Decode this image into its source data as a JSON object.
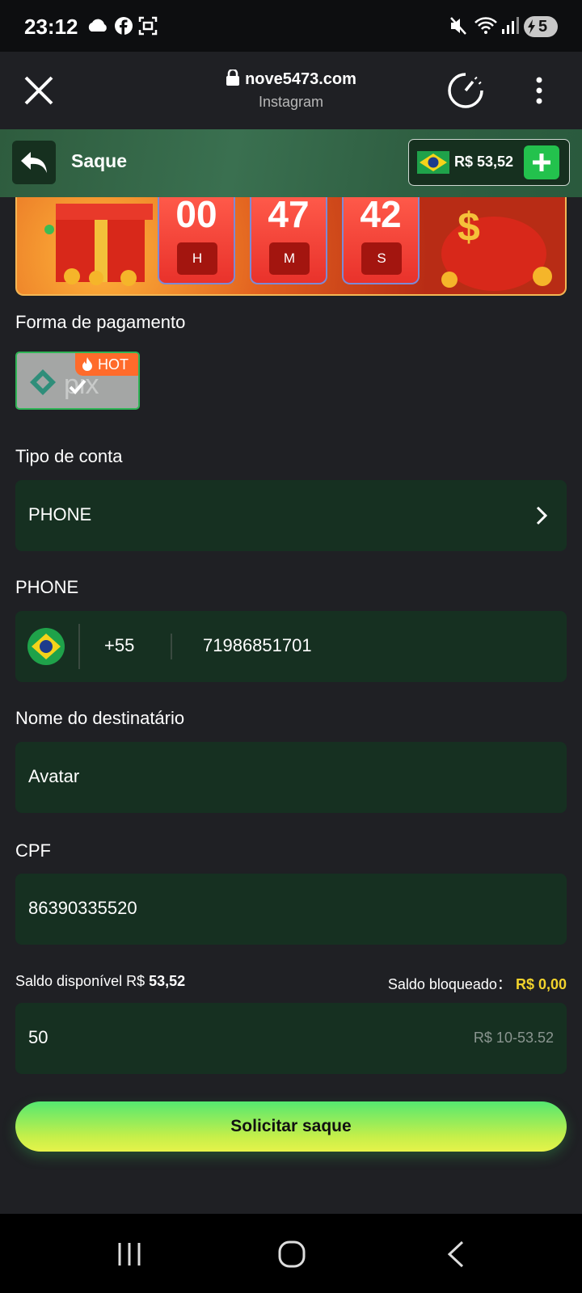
{
  "status_bar": {
    "time": "23:12",
    "battery": "5"
  },
  "browser": {
    "url": "nove5473.com",
    "source": "Instagram"
  },
  "header": {
    "title": "Saque",
    "balance": "R$ 53,52"
  },
  "timer": {
    "hours": "00",
    "minutes": "47",
    "seconds": "42",
    "h_label": "H",
    "m_label": "M",
    "s_label": "S"
  },
  "payment": {
    "label": "Forma de pagamento",
    "method": "pix",
    "badge": "HOT"
  },
  "account_type": {
    "label": "Tipo de conta",
    "value": "PHONE"
  },
  "phone": {
    "label": "PHONE",
    "country_code": "+55",
    "number": "71986851701"
  },
  "recipient": {
    "label": "Nome do destinatário",
    "value": "Avatar"
  },
  "cpf": {
    "label": "CPF",
    "value": "86390335520"
  },
  "balances": {
    "available_label": "Saldo disponível R$",
    "available_value": "53,52",
    "blocked_label": "Saldo bloqueado：",
    "blocked_value": "R$ 0,00"
  },
  "amount": {
    "value": "50",
    "range": "R$ 10-53.52"
  },
  "submit_label": "Solicitar saque",
  "colors": {
    "accent_green": "#23c24d",
    "field_bg": "#163021",
    "blocked_yellow": "#f2d32c"
  }
}
